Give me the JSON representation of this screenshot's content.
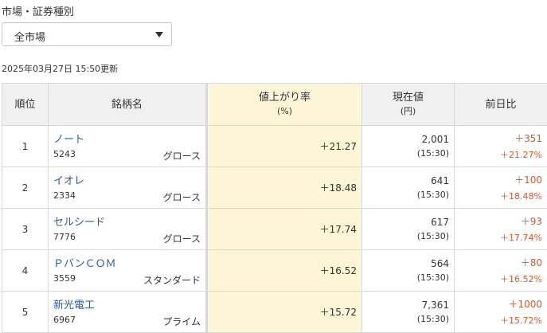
{
  "filter": {
    "label": "市場・証券種別",
    "selected": "全市場"
  },
  "updated_text": "2025年03月27日 15:50更新",
  "table": {
    "headers": {
      "rank": "順位",
      "name": "銘柄名",
      "rate": "値上がり率",
      "rate_unit": "(%)",
      "price": "現在値",
      "price_unit": "(円)",
      "change": "前日比"
    },
    "rows": [
      {
        "rank": "1",
        "name": "ノート",
        "code": "5243",
        "segment": "グロース",
        "rate": "＋21.27",
        "price": "2,001",
        "time": "(15:30)",
        "change": "＋351",
        "change_pct": "＋21.27%"
      },
      {
        "rank": "2",
        "name": "イオレ",
        "code": "2334",
        "segment": "グロース",
        "rate": "＋18.48",
        "price": "641",
        "time": "(15:30)",
        "change": "＋100",
        "change_pct": "＋18.48%"
      },
      {
        "rank": "3",
        "name": "セルシード",
        "code": "7776",
        "segment": "グロース",
        "rate": "＋17.74",
        "price": "617",
        "time": "(15:30)",
        "change": "＋93",
        "change_pct": "＋17.74%"
      },
      {
        "rank": "4",
        "name": "ＰバンＣＯＭ",
        "code": "3559",
        "segment": "スタンダード",
        "rate": "＋16.52",
        "price": "564",
        "time": "(15:30)",
        "change": "＋80",
        "change_pct": "＋16.52%"
      },
      {
        "rank": "5",
        "name": "新光電工",
        "code": "6967",
        "segment": "プライム",
        "rate": "＋15.72",
        "price": "7,361",
        "time": "(15:30)",
        "change": "＋1000",
        "change_pct": "＋15.72%"
      }
    ]
  }
}
